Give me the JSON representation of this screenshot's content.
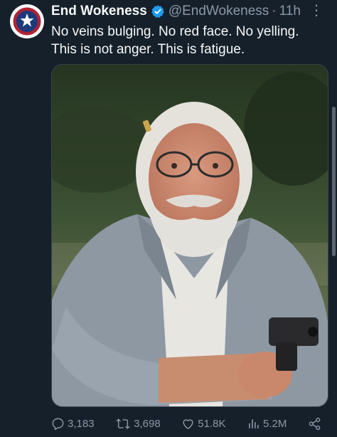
{
  "author": {
    "display_name": "End Wokeness",
    "handle": "@EndWokeness",
    "separator": "·",
    "time": "11h",
    "avatar_icon": "patch-logo-icon",
    "verified_color": "#1d9bf0"
  },
  "tweet": {
    "lines": [
      "No veins bulging. No red face. No yelling.",
      "This is not anger. This is fatigue."
    ]
  },
  "actions": {
    "replies": "3,183",
    "reposts": "3,698",
    "likes": "51.8K",
    "views": "5.2M"
  },
  "colors": {
    "background": "#15202b",
    "text": "#f7f9f9",
    "secondary": "#8b98a5"
  }
}
